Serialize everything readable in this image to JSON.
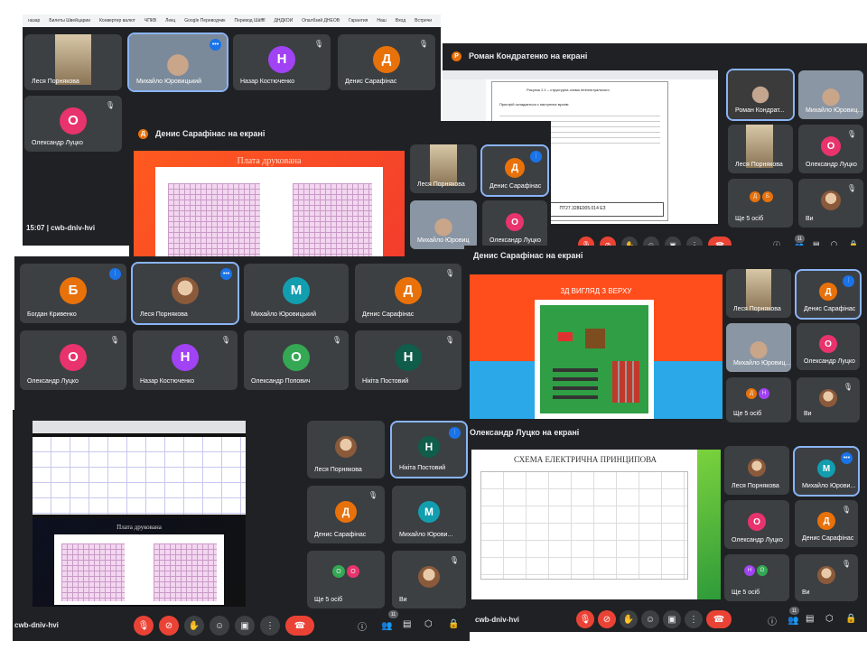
{
  "bookmarks": [
    "назар",
    "Билеты Швейцарии",
    "Конвертер валют",
    "ЧПКВ",
    "Лекц",
    "Google Переводчик",
    "Перевод Шäfffl",
    "ДНДКОИ",
    "Опалбзий ДНЕОВ",
    "Гарантия",
    "Наш",
    "Вход",
    "Встречи"
  ],
  "w1": {
    "tiles": [
      {
        "label": "Леся Порнякова",
        "type": "cam"
      },
      {
        "label": "Михайло Юровицький",
        "type": "cam",
        "active": true
      },
      {
        "label": "Назар Костюченко",
        "letter": "Н",
        "color": "#a142f4"
      },
      {
        "label": "Денис Сарафінас",
        "letter": "Д",
        "color": "#e8710a"
      },
      {
        "label": "Олександр Луцко",
        "letter": "О",
        "color": "#e8336d"
      }
    ],
    "time": "15:07",
    "code": "cwb-dniv-hvi"
  },
  "w2": {
    "bar": "Денис Сарафінас на екрані",
    "bar_initial": "Д",
    "slide_title": "Плата друкована",
    "tiles": [
      {
        "label": "Леся Порнякова",
        "type": "cam"
      },
      {
        "label": "Денис Сарафінас",
        "letter": "Д",
        "color": "#e8710a",
        "active": true
      },
      {
        "label": "Михайло Юровиц",
        "type": "cam"
      },
      {
        "label": "Олександр Луцко",
        "letter": "О",
        "color": "#e8336d"
      }
    ]
  },
  "w3": {
    "bar": "Роман Кондратенко на екрані",
    "bar_initial": "Р",
    "doc_title": "Рисунок 2.1 – структурна схема інтелектуального",
    "doc_text": "Пристрій складається з наступних вузлів:",
    "doc_stamp": "ПТ27.328Е005.014 ЕЗ",
    "tiles": [
      {
        "label": "Роман Кондрат...",
        "type": "cam",
        "active": true
      },
      {
        "label": "Михайло Юровиц...",
        "type": "cam"
      },
      {
        "label": "Леся Порнякова",
        "type": "cam"
      },
      {
        "label": "Олександр Луцко",
        "letter": "О",
        "color": "#e8336d"
      },
      {
        "label": "Ще 5 осіб",
        "type": "more"
      },
      {
        "label": "Ви",
        "type": "photo"
      }
    ],
    "badge": "11"
  },
  "w4": {
    "tiles": [
      {
        "label": "Богдан Кривенко",
        "letter": "Б",
        "color": "#e8710a"
      },
      {
        "label": "Леся Порнякова",
        "type": "photo",
        "active": true
      },
      {
        "label": "Михайло Юровицький",
        "letter": "М",
        "color": "#129eaf"
      },
      {
        "label": "Денис Сарафінас",
        "letter": "Д",
        "color": "#e8710a"
      },
      {
        "label": "Олександр Луцко",
        "letter": "О",
        "color": "#e8336d"
      },
      {
        "label": "Назар Костюченко",
        "letter": "Н",
        "color": "#a142f4"
      },
      {
        "label": "Олександр Попович",
        "letter": "О",
        "color": "#34a853"
      },
      {
        "label": "Нікіта Постовий",
        "letter": "Н",
        "color": "#0f5d4a"
      }
    ]
  },
  "w5": {
    "bar": "Денис Сарафінас на екрані",
    "slide_title": "3Д ВИГЛЯД З ВЕРХУ",
    "tiles": [
      {
        "label": "Леся Порнякова",
        "type": "cam"
      },
      {
        "label": "Денис Сарафінас",
        "letter": "Д",
        "color": "#e8710a",
        "active": true
      },
      {
        "label": "Михайло Юровиц...",
        "type": "cam"
      },
      {
        "label": "Олександр Луцко",
        "letter": "О",
        "color": "#e8336d"
      },
      {
        "label": "Ще 5 осіб",
        "type": "more"
      },
      {
        "label": "Ви",
        "type": "photo"
      }
    ]
  },
  "w6": {
    "slide_title": "Плата друкована",
    "tiles": [
      {
        "label": "Леся Порнякова",
        "type": "photo"
      },
      {
        "label": "Нікіта Постовий",
        "letter": "Н",
        "color": "#0f5d4a",
        "active": true
      },
      {
        "label": "Денис Сарафінас",
        "letter": "Д",
        "color": "#e8710a"
      },
      {
        "label": "Михайло Юрови...",
        "letter": "М",
        "color": "#129eaf"
      },
      {
        "label": "Ще 5 осіб",
        "type": "more"
      },
      {
        "label": "Ви",
        "type": "photo"
      }
    ],
    "code": "cwb-dniv-hvi",
    "badge": "11"
  },
  "w7": {
    "bar": "Олександр Луцко на екрані",
    "slide_title": "СХЕМА ЕЛЕКТРИЧНА ПРИНЦИПОВА",
    "tiles": [
      {
        "label": "Леся Порнякова",
        "type": "photo"
      },
      {
        "label": "Михайло Юрови...",
        "letter": "М",
        "color": "#129eaf",
        "active": true
      },
      {
        "label": "Олександр Луцко",
        "letter": "О",
        "color": "#e8336d"
      },
      {
        "label": "Денис Сарафінас",
        "letter": "Д",
        "color": "#e8710a"
      },
      {
        "label": "Ще 5 осіб",
        "type": "more"
      },
      {
        "label": "Ви",
        "type": "photo"
      }
    ],
    "code": "cwb-dniv-hvi",
    "badge": "11"
  },
  "colors": {
    "bg": "#202124",
    "tile": "#3c4043",
    "accent": "#8ab4f8",
    "red": "#ea4335"
  },
  "icons": [
    "mic-off-icon",
    "camera-off-icon",
    "hand-icon",
    "emoji-icon",
    "present-icon",
    "more-icon",
    "end-call-icon",
    "info-icon",
    "people-icon",
    "chat-icon",
    "activities-icon",
    "lock-icon"
  ]
}
